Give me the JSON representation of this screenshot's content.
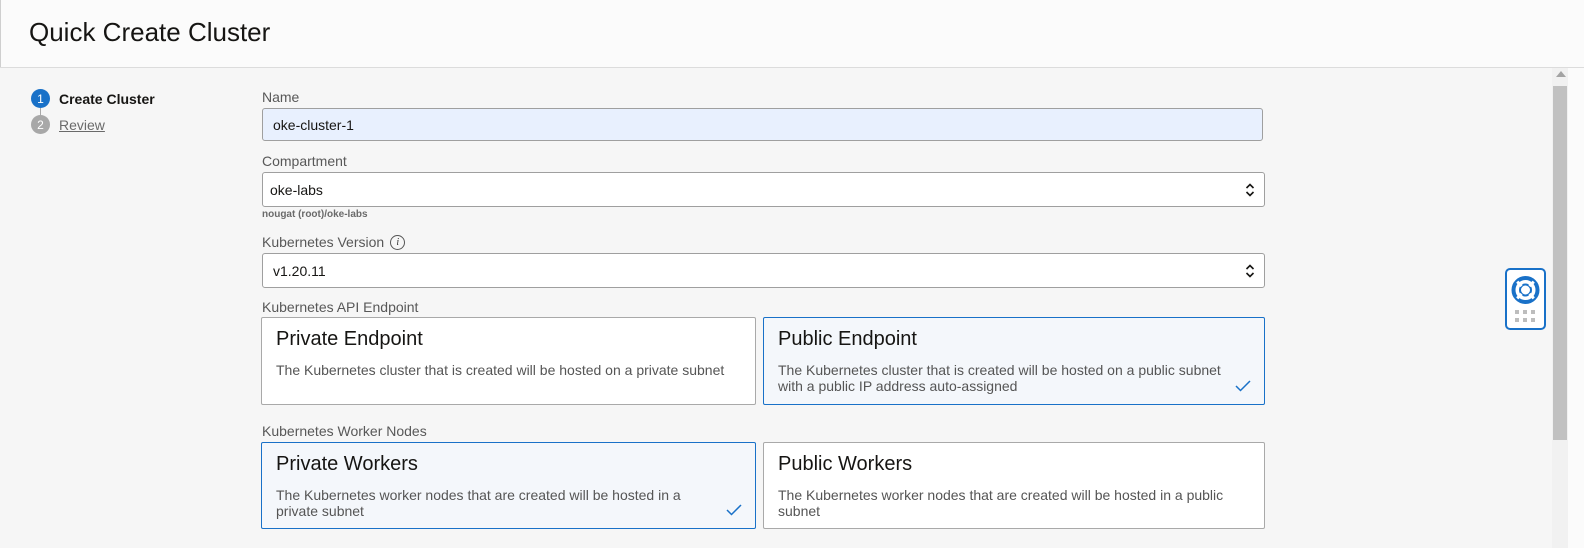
{
  "page": {
    "title": "Quick Create Cluster"
  },
  "steps": [
    {
      "number": "1",
      "label": "Create Cluster",
      "state": "active"
    },
    {
      "number": "2",
      "label": "Review",
      "state": "link"
    }
  ],
  "form": {
    "name": {
      "label": "Name",
      "value": "oke-cluster-1"
    },
    "compartment": {
      "label": "Compartment",
      "value": "oke-labs",
      "path": "nougat (root)/oke-labs"
    },
    "kubernetes_version": {
      "label": "Kubernetes Version",
      "value": "v1.20.11",
      "info_icon": "info-icon"
    },
    "api_endpoint": {
      "label": "Kubernetes API Endpoint",
      "options": [
        {
          "title": "Private Endpoint",
          "description": "The Kubernetes cluster that is created will be hosted on a private subnet",
          "selected": false
        },
        {
          "title": "Public Endpoint",
          "description": "The Kubernetes cluster that is created will be hosted on a public subnet with a public IP address auto-assigned",
          "selected": true
        }
      ]
    },
    "worker_nodes": {
      "label": "Kubernetes Worker Nodes",
      "options": [
        {
          "title": "Private Workers",
          "description": "The Kubernetes worker nodes that are created will be hosted in a private subnet",
          "selected": true
        },
        {
          "title": "Public Workers",
          "description": "The Kubernetes worker nodes that are created will be hosted in a public subnet",
          "selected": false
        }
      ]
    }
  },
  "icons": {
    "help": "lifebuoy-icon",
    "apps": "grid-icon",
    "check": "checkmark-icon",
    "select": "up-down-chevron-icon"
  },
  "colors": {
    "accent": "#1971c8",
    "step_inactive": "#a8a8a8",
    "input_autofill": "#e8f0fe"
  }
}
